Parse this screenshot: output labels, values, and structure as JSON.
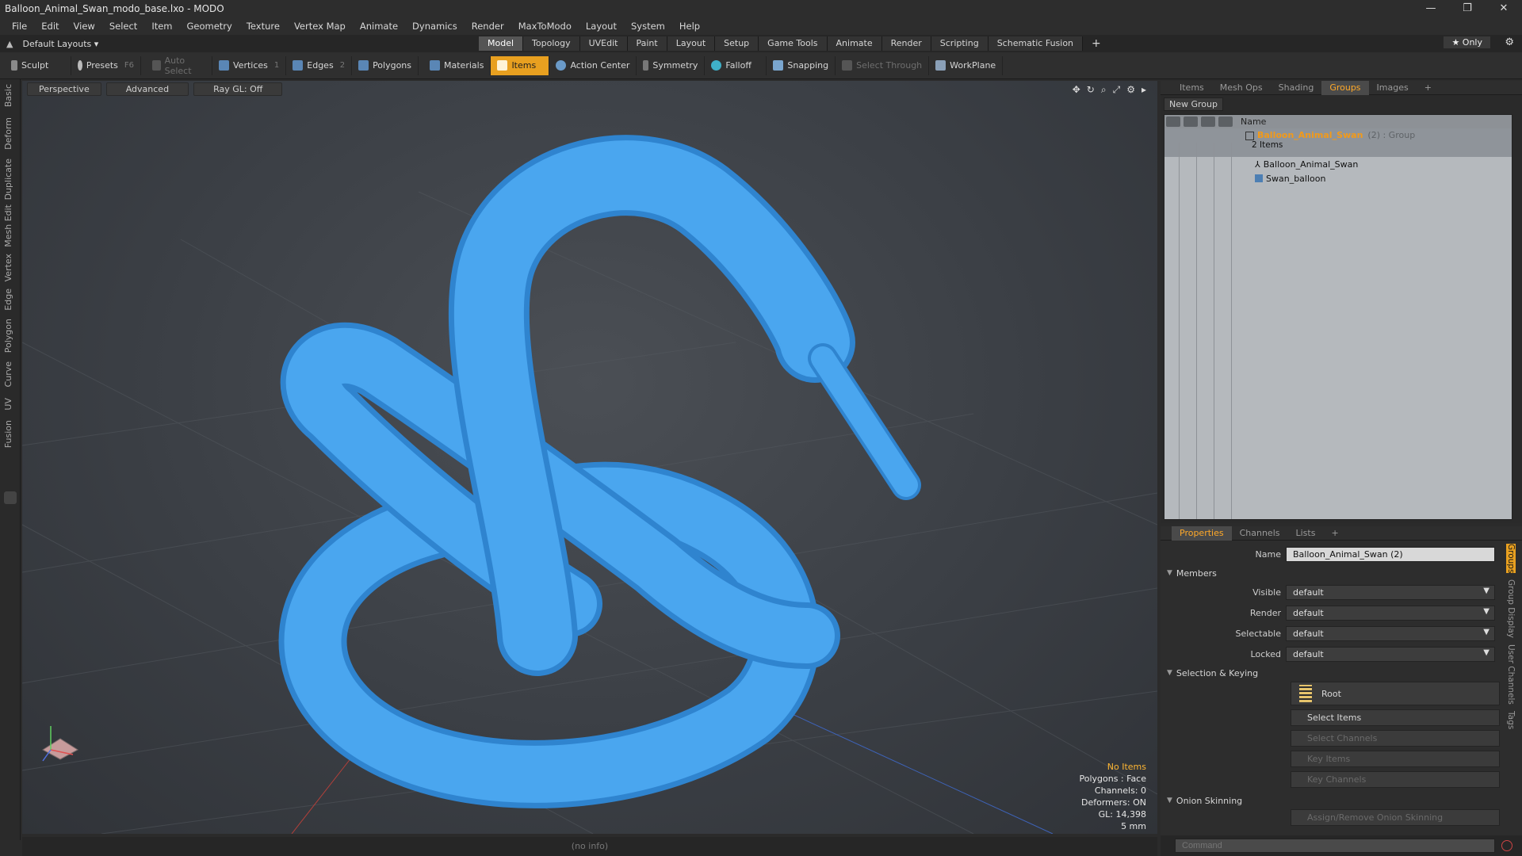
{
  "window": {
    "title": "Balloon_Animal_Swan_modo_base.lxo - MODO",
    "controls": [
      "—",
      "❐",
      "✕"
    ]
  },
  "menu": [
    "File",
    "Edit",
    "View",
    "Select",
    "Item",
    "Geometry",
    "Texture",
    "Vertex Map",
    "Animate",
    "Dynamics",
    "Render",
    "MaxToModo",
    "Layout",
    "System",
    "Help"
  ],
  "layout_bar": {
    "preset": "Default Layouts ▾",
    "tabs": [
      "Model",
      "Topology",
      "UVEdit",
      "Paint",
      "Layout",
      "Setup",
      "Game Tools",
      "Animate",
      "Render",
      "Scripting",
      "Schematic Fusion"
    ],
    "active_tab": "Model",
    "add": "+",
    "only": "★  Only"
  },
  "toolbar": {
    "sculpt": "Sculpt",
    "presets": "Presets",
    "presets_key": "F6",
    "auto_select": "Auto Select",
    "vertices": "Vertices",
    "vertices_key": "1",
    "edges": "Edges",
    "edges_key": "2",
    "polygons": "Polygons",
    "materials": "Materials",
    "items": "Items",
    "action_center": "Action Center",
    "symmetry": "Symmetry",
    "falloff": "Falloff",
    "snapping": "Snapping",
    "select_through": "Select Through",
    "workplane": "WorkPlane"
  },
  "left_tabs": [
    "Basic",
    "Deform",
    "Duplicate",
    "Mesh Edit",
    "Vertex",
    "Edge",
    "Polygon",
    "Curve",
    "UV",
    "Fusion"
  ],
  "viewport": {
    "view": "Perspective",
    "shading": "Advanced",
    "raygl": "Ray GL: Off",
    "model_color": "#4aa6ef",
    "hud": {
      "selection": "No Items",
      "polygons": "Polygons : Face",
      "channels": "Channels: 0",
      "deformers": "Deformers: ON",
      "gl": "GL: 14,398",
      "scale": "5 mm"
    },
    "status": "(no info)"
  },
  "groups_panel": {
    "tabs": [
      "Items",
      "Mesh Ops",
      "Shading",
      "Groups",
      "Images",
      "+"
    ],
    "active_tab": "Groups",
    "new_group": "New Group",
    "column_name": "Name",
    "group": {
      "name": "Balloon_Animal_Swan",
      "meta": "(2) : Group",
      "count": "2 Items"
    },
    "members": [
      "Balloon_Animal_Swan",
      "Swan_balloon"
    ]
  },
  "properties_panel": {
    "tabs": [
      "Properties",
      "Channels",
      "Lists",
      "+"
    ],
    "active_tab": "Properties",
    "name_label": "Name",
    "name_value": "Balloon_Animal_Swan (2)",
    "members_section": "Members",
    "visible_label": "Visible",
    "visible_value": "default",
    "render_label": "Render",
    "render_value": "default",
    "selectable_label": "Selectable",
    "selectable_value": "default",
    "locked_label": "Locked",
    "locked_value": "default",
    "selection_section": "Selection & Keying",
    "root": "Root",
    "select_items": "Select Items",
    "select_channels": "Select Channels",
    "key_items": "Key Items",
    "key_channels": "Key Channels",
    "onion_section": "Onion Skinning",
    "assign_onion": "Assign/Remove Onion Skinning",
    "side_tabs": [
      "Groups",
      "Group Display",
      "User Channels",
      "Tags"
    ]
  },
  "command": {
    "placeholder": "Command"
  }
}
